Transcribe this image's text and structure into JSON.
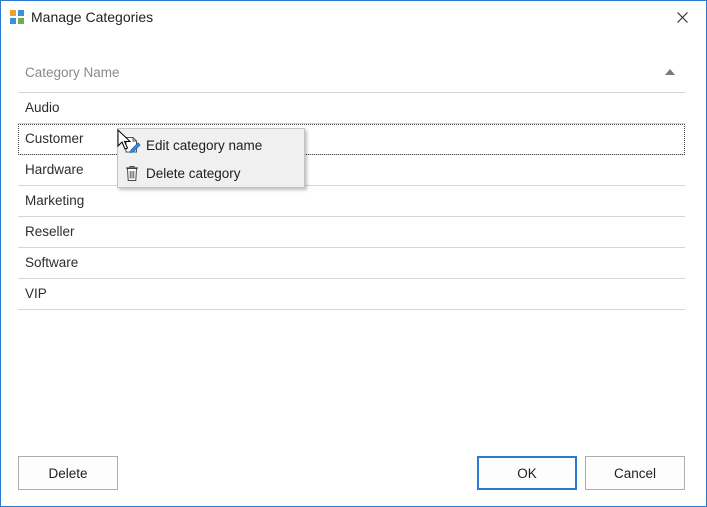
{
  "window": {
    "title": "Manage Categories",
    "accent_color": "#2b79d0",
    "icon": "app-grid-icon",
    "close_icon": "close-icon"
  },
  "grid": {
    "column_header": "Category Name",
    "sort_direction": "ascending",
    "rows": [
      {
        "name": "Audio"
      },
      {
        "name": "Customer",
        "selected": true
      },
      {
        "name": "Hardware"
      },
      {
        "name": "Marketing"
      },
      {
        "name": "Reseller"
      },
      {
        "name": "Software"
      },
      {
        "name": "VIP"
      }
    ]
  },
  "context_menu": {
    "items": [
      {
        "label": "Edit category name",
        "icon": "edit-icon"
      },
      {
        "label": "Delete category",
        "icon": "trash-icon"
      }
    ]
  },
  "buttons": {
    "delete": "Delete",
    "ok": "OK",
    "cancel": "Cancel"
  }
}
